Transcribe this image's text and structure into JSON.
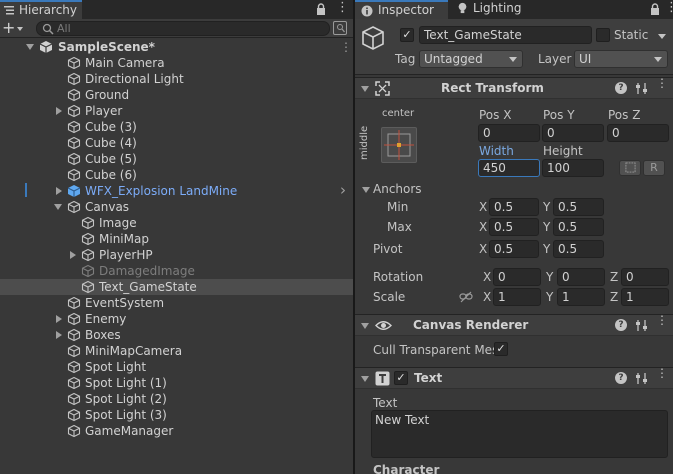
{
  "hierarchy": {
    "tab_label": "Hierarchy",
    "add_label": "+",
    "search_placeholder": "All",
    "items": [
      {
        "label": "SampleScene*",
        "depth": 0,
        "expand": "down",
        "kind": "scene"
      },
      {
        "label": "Main Camera",
        "depth": 1,
        "expand": "none",
        "kind": "object"
      },
      {
        "label": "Directional Light",
        "depth": 1,
        "expand": "none",
        "kind": "object"
      },
      {
        "label": "Ground",
        "depth": 1,
        "expand": "none",
        "kind": "object"
      },
      {
        "label": "Player",
        "depth": 1,
        "expand": "right",
        "kind": "object"
      },
      {
        "label": "Cube (3)",
        "depth": 1,
        "expand": "none",
        "kind": "object"
      },
      {
        "label": "Cube (4)",
        "depth": 1,
        "expand": "none",
        "kind": "object"
      },
      {
        "label": "Cube (5)",
        "depth": 1,
        "expand": "none",
        "kind": "object"
      },
      {
        "label": "Cube (6)",
        "depth": 1,
        "expand": "none",
        "kind": "object"
      },
      {
        "label": "WFX_Explosion LandMine",
        "depth": 1,
        "expand": "right",
        "kind": "prefab"
      },
      {
        "label": "Canvas",
        "depth": 1,
        "expand": "down",
        "kind": "object"
      },
      {
        "label": "Image",
        "depth": 2,
        "expand": "none",
        "kind": "object"
      },
      {
        "label": "MiniMap",
        "depth": 2,
        "expand": "none",
        "kind": "object"
      },
      {
        "label": "PlayerHP",
        "depth": 2,
        "expand": "right",
        "kind": "object"
      },
      {
        "label": "DamagedImage",
        "depth": 2,
        "expand": "none",
        "kind": "inactive"
      },
      {
        "label": "Text_GameState",
        "depth": 2,
        "expand": "none",
        "kind": "selected"
      },
      {
        "label": "EventSystem",
        "depth": 1,
        "expand": "none",
        "kind": "object"
      },
      {
        "label": "Enemy",
        "depth": 1,
        "expand": "right",
        "kind": "object"
      },
      {
        "label": "Boxes",
        "depth": 1,
        "expand": "right",
        "kind": "object"
      },
      {
        "label": "MiniMapCamera",
        "depth": 1,
        "expand": "none",
        "kind": "object"
      },
      {
        "label": "Spot Light",
        "depth": 1,
        "expand": "none",
        "kind": "object"
      },
      {
        "label": "Spot Light (1)",
        "depth": 1,
        "expand": "none",
        "kind": "object"
      },
      {
        "label": "Spot Light (2)",
        "depth": 1,
        "expand": "none",
        "kind": "object"
      },
      {
        "label": "Spot Light (3)",
        "depth": 1,
        "expand": "none",
        "kind": "object"
      },
      {
        "label": "GameManager",
        "depth": 1,
        "expand": "none",
        "kind": "object"
      }
    ]
  },
  "inspector": {
    "tab_inspector": "Inspector",
    "tab_lighting": "Lighting",
    "object": {
      "active": true,
      "name": "Text_GameState",
      "static_label": "Static",
      "static_checked": false,
      "tag_label": "Tag",
      "tag_value": "Untagged",
      "layer_label": "Layer",
      "layer_value": "UI"
    },
    "rect_transform": {
      "title": "Rect Transform",
      "anchor_h": "center",
      "anchor_v": "middle",
      "pos_x_label": "Pos X",
      "pos_y_label": "Pos Y",
      "pos_z_label": "Pos Z",
      "pos_x": "0",
      "pos_y": "0",
      "pos_z": "0",
      "width_label": "Width",
      "height_label": "Height",
      "width": "450",
      "height": "100",
      "blueprint_btn": "",
      "raw_btn": "R",
      "anchors_label": "Anchors",
      "min_label": "Min",
      "max_label": "Max",
      "min_x": "0.5",
      "min_y": "0.5",
      "max_x": "0.5",
      "max_y": "0.5",
      "pivot_label": "Pivot",
      "pivot_x": "0.5",
      "pivot_y": "0.5",
      "rotation_label": "Rotation",
      "rot_x": "0",
      "rot_y": "0",
      "rot_z": "0",
      "scale_label": "Scale",
      "scale_x": "1",
      "scale_y": "1",
      "scale_z": "1",
      "axis_x": "X",
      "axis_y": "Y",
      "axis_z": "Z"
    },
    "canvas_renderer": {
      "title": "Canvas Renderer",
      "cull_label": "Cull Transparent Mes",
      "cull_checked": true
    },
    "text": {
      "title": "Text",
      "enabled": true,
      "text_label": "Text",
      "text_value": "New Text",
      "character_label": "Character"
    },
    "help_glyph": "?"
  },
  "colors": {
    "accent": "#3a79bb",
    "prefab_text": "#7cacf8",
    "panel_bg": "#383838",
    "field_bg": "#2a2a2a"
  }
}
